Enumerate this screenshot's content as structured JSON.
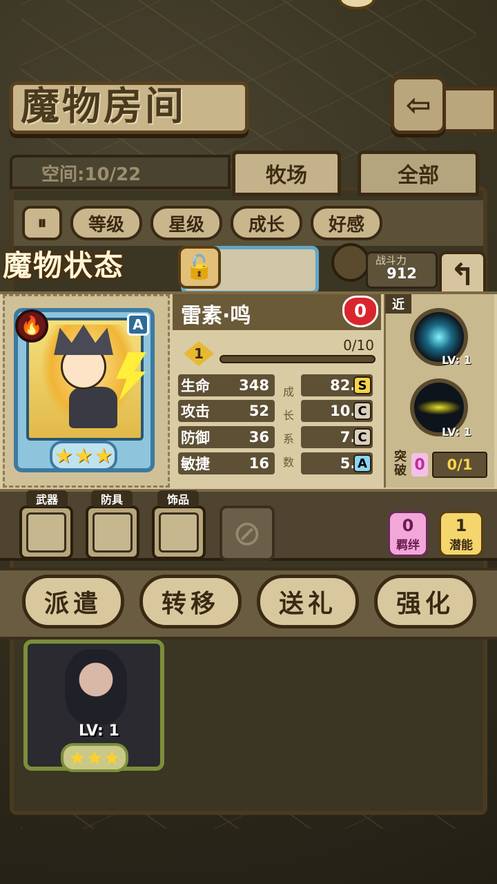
{
  "header": {
    "title": "魔物房间",
    "space_label": "空间:10/22",
    "tabs": [
      "牧场",
      "全部"
    ]
  },
  "sort_buttons": [
    "等级",
    "星级",
    "成长",
    "好感"
  ],
  "status_panel": {
    "title": "魔物状态",
    "power_label": "战斗力",
    "power_value": "912",
    "monster_name": "雷素·鸣",
    "affection": "0",
    "rank": "A",
    "stars": 3,
    "level": "1",
    "exp": "0/10",
    "exp_progress": 0,
    "growth_vertical_label": [
      "成",
      "长",
      "系",
      "数"
    ],
    "stats": [
      {
        "label": "生命",
        "value": "348",
        "growth": "82.1",
        "grade": "S"
      },
      {
        "label": "攻击",
        "value": "52",
        "growth": "10.2",
        "grade": "C"
      },
      {
        "label": "防御",
        "value": "36",
        "growth": "7.0",
        "grade": "C"
      },
      {
        "label": "敏捷",
        "value": "16",
        "growth": "5.9",
        "grade": "A"
      }
    ],
    "skill_tag": "近",
    "skills": [
      {
        "name": "electric-skill",
        "level": "LV: 1"
      },
      {
        "name": "dash-skill",
        "level": "LV: 1"
      }
    ],
    "breakthrough_label": "突破",
    "breakthrough_count": "0",
    "breakthrough_progress": "0/1"
  },
  "equipment": {
    "slots": [
      "武器",
      "防具",
      "饰品"
    ],
    "bond_value": "0",
    "bond_label": "羁绊",
    "potential_value": "1",
    "potential_label": "潜能"
  },
  "actions": [
    "派遣",
    "转移",
    "送礼",
    "强化"
  ],
  "list_card": {
    "level": "LV: 1",
    "stars": 3
  },
  "colors": {
    "grade_S": "#f4d54a",
    "grade_C": "#d8d0bc",
    "grade_A": "#8ad6f2",
    "accent_gold": "#e7b830"
  }
}
